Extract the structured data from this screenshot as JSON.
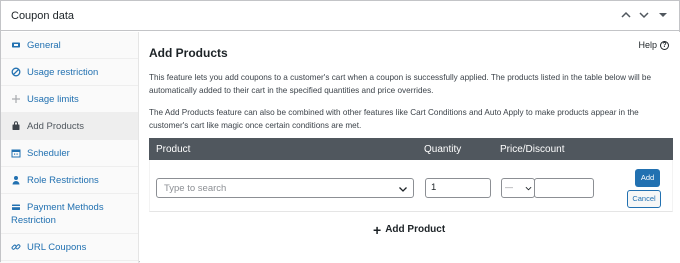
{
  "panel": {
    "title": "Coupon data"
  },
  "sidebar": {
    "items": [
      {
        "label": "General",
        "icon": "ticket-icon"
      },
      {
        "label": "Usage restriction",
        "icon": "block-icon"
      },
      {
        "label": "Usage limits",
        "icon": "plus-cross-icon"
      },
      {
        "label": "Add Products",
        "icon": "shopping-bag-icon",
        "active": true
      },
      {
        "label": "Scheduler",
        "icon": "calendar-icon"
      },
      {
        "label": "Role Restrictions",
        "icon": "user-icon"
      },
      {
        "label_line1": "Payment Methods",
        "label_line2": "Restriction",
        "icon": "payment-icon"
      },
      {
        "label": "URL Coupons",
        "icon": "link-icon"
      }
    ]
  },
  "main": {
    "title": "Add Products",
    "help_label": "Help",
    "description_1": "This feature lets you add coupons to a customer's cart when a coupon is successfully applied. The products listed in the table below will be automatically added to their cart in the specified quantities and price overrides.",
    "description_2": "The Add Products feature can also be combined with other features like Cart Conditions and Auto Apply to make products appear in the customer's cart like magic once certain conditions are met.",
    "table": {
      "headers": {
        "product": "Product",
        "quantity": "Quantity",
        "price": "Price/Discount"
      },
      "row": {
        "product_placeholder": "Type to search",
        "quantity_value": "1",
        "type_value": "—",
        "price_value": ""
      },
      "add_button": "Add",
      "cancel_button": "Cancel"
    },
    "add_product_link": "Add Product"
  }
}
